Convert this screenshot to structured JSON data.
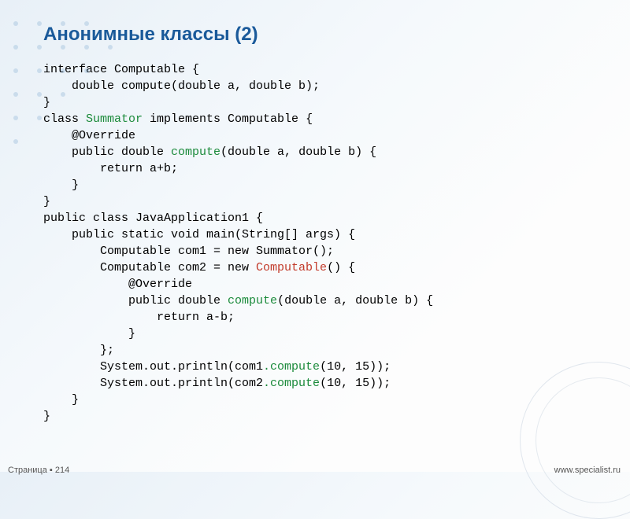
{
  "title": "Анонимные классы (2)",
  "code": {
    "l01a": "interface Computable {",
    "l02a": "    double compute(double a, double b);",
    "l03a": "}",
    "l04a": "class ",
    "l04b": "Summator",
    "l04c": " implements Computable {",
    "l05a": "    @Override",
    "l06a": "    public double ",
    "l06b": "compute",
    "l06c": "(double a, double b) {",
    "l07a": "        return a+b;",
    "l08a": "    }",
    "l09a": "}",
    "l10a": "public class JavaApplication1 {",
    "l11a": "    public static void main(String[] args) {",
    "l12a": "        Computable com1 = new Summator();",
    "l13a": "        Computable com2 = new ",
    "l13b": "Computable",
    "l13c": "() {",
    "l14a": "            @Override",
    "l15a": "            public double ",
    "l15b": "compute",
    "l15c": "(double a, double b) {",
    "l16a": "                return a-b;",
    "l17a": "            }",
    "l18a": "        };",
    "l19a": "        System.out.println(com1",
    "l19b": ".compute",
    "l19c": "(10, 15));",
    "l20a": "        System.out.println(com2",
    "l20b": ".compute",
    "l20c": "(10, 15));",
    "l21a": "    }",
    "l22a": "}"
  },
  "footer": {
    "page_label": "Страница",
    "page_sep": " ▪ ",
    "page_num": "214",
    "url": "www.specialist.ru"
  }
}
